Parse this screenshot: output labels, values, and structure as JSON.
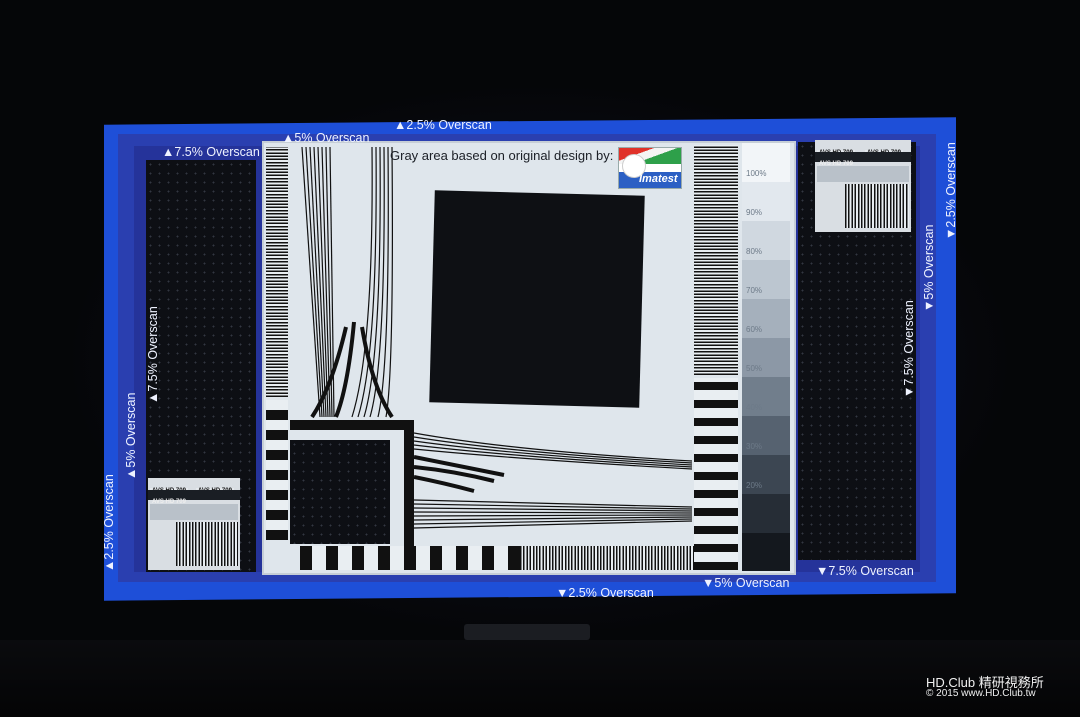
{
  "overscan": {
    "top_25": "▲2.5% Overscan",
    "top_5": "▲5% Overscan",
    "top_75": "▲7.5% Overscan",
    "bottom_25": "▼2.5% Overscan",
    "bottom_5": "▼5% Overscan",
    "bottom_75": "▼7.5% Overscan",
    "left_25": "▲2.5% Overscan",
    "left_5": "▲5% Overscan",
    "left_75": "▲7.5% Overscan",
    "right_25": "▼2.5% Overscan",
    "right_5": "▼5% Overscan",
    "right_75": "▼7.5% Overscan"
  },
  "header": {
    "credit": "Gray area based on original design by:",
    "logo_text": "Imatest"
  },
  "gray_scale": [
    "100%",
    "90%",
    "80%",
    "70%",
    "60%",
    "50%",
    "40%",
    "30%",
    "20%",
    "",
    ""
  ],
  "mini_chart": {
    "label_a": "AVS HD 709",
    "label_b": "AVS HD 709",
    "label_small": "AVS HD 709"
  },
  "watermark": {
    "line1": "HD.Club 精研視務所",
    "line2": "© 2015  www.HD.Club.tw"
  },
  "colors": {
    "overscan_25": "#1e4fd8",
    "overscan_5": "#2a3fb0",
    "overscan_75": "#25339a",
    "chart_bg": "#dfe6ec"
  }
}
